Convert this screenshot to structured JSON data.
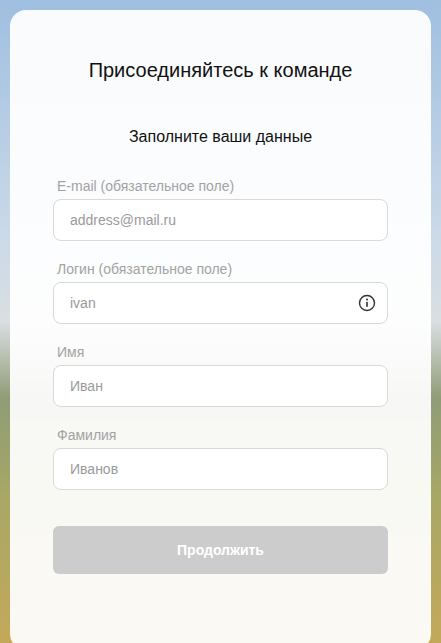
{
  "form": {
    "title": "Присоединяйтесь к команде",
    "subtitle": "Заполните ваши данные",
    "fields": [
      {
        "label": "E-mail (обязательное поле)",
        "placeholder": "address@mail.ru",
        "kind": "plain"
      },
      {
        "label": "Логин (обязательное поле)",
        "placeholder": "ivan",
        "kind": "info"
      },
      {
        "label": "Имя",
        "placeholder": "Иван",
        "kind": "plain"
      },
      {
        "label": "Фамилия",
        "placeholder": "Иванов",
        "kind": "plain"
      }
    ],
    "submit": {
      "label": "Продолжить",
      "disabled": true
    }
  }
}
